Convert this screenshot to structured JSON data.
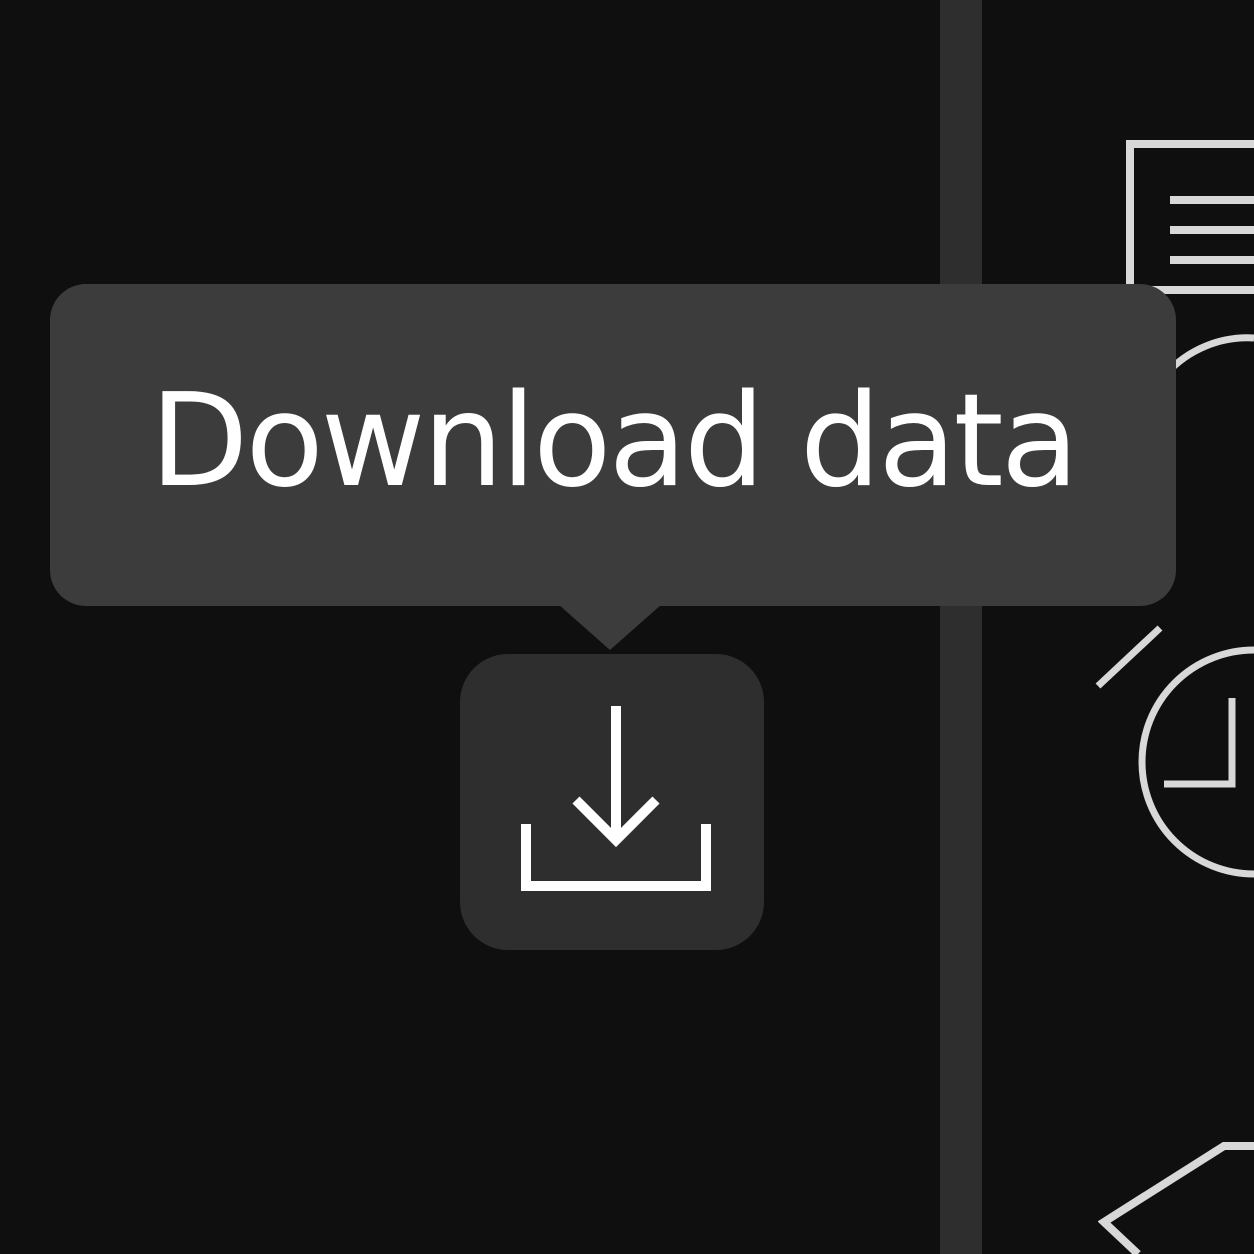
{
  "tooltip": {
    "text": "Download data"
  },
  "download_button": {
    "icon": "download-icon"
  },
  "right_toolbar": {
    "icons": [
      "list-icon",
      "clock-icon",
      "alarm-clock-icon",
      "diamond-icon"
    ]
  },
  "colors": {
    "background": "#0f0f0f",
    "divider": "#2e2e2e",
    "button_background": "#2e2e2e",
    "tooltip_background": "#3c3c3c",
    "icon_stroke": "#ffffff",
    "side_icon_stroke": "#d8d8d8"
  }
}
